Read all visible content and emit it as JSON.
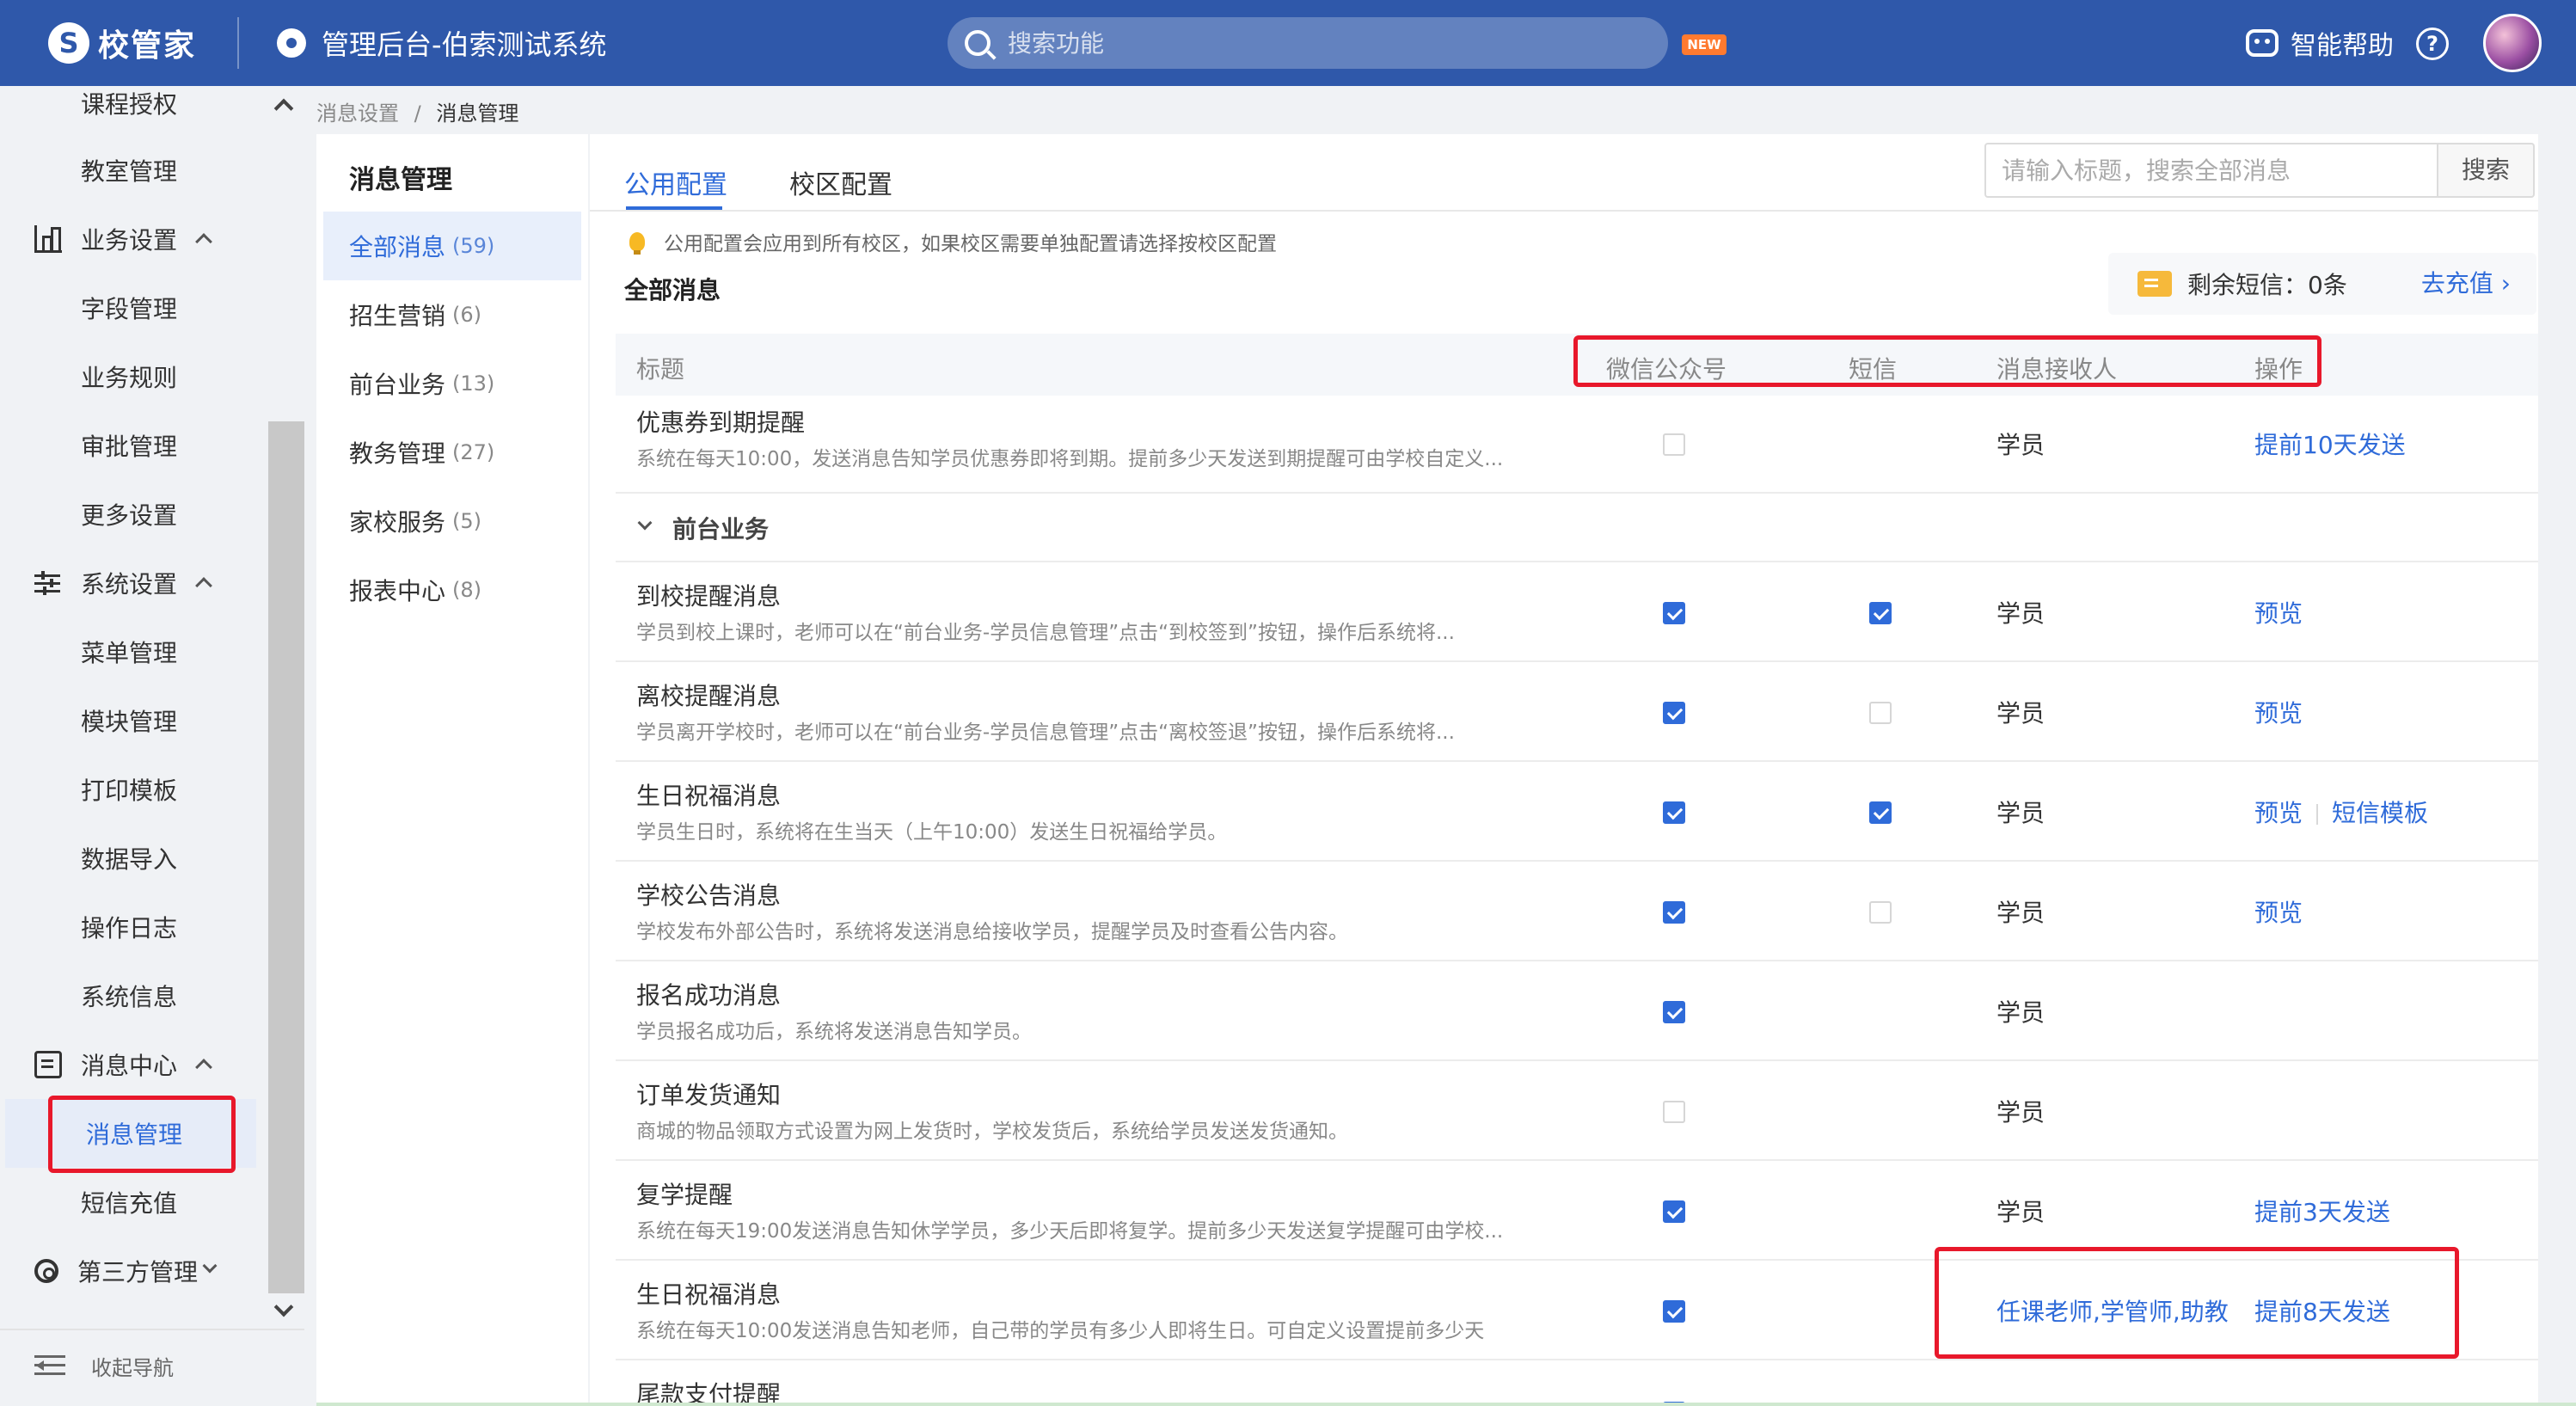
{
  "topbar": {
    "logo_mark": "S",
    "logo_text": "校管家",
    "app_title": "管理后台-伯索测试系统",
    "search_placeholder": "搜索功能",
    "new_badge": "NEW",
    "help_label": "智能帮助",
    "question_symbol": "?"
  },
  "sidebar": {
    "items": [
      {
        "label": "课程授权"
      },
      {
        "label": "教室管理"
      },
      {
        "label": "业务设置"
      },
      {
        "label": "字段管理"
      },
      {
        "label": "业务规则"
      },
      {
        "label": "审批管理"
      },
      {
        "label": "更多设置"
      },
      {
        "label": "系统设置"
      },
      {
        "label": "菜单管理"
      },
      {
        "label": "模块管理"
      },
      {
        "label": "打印模板"
      },
      {
        "label": "数据导入"
      },
      {
        "label": "操作日志"
      },
      {
        "label": "系统信息"
      },
      {
        "label": "消息中心"
      },
      {
        "label": "消息管理"
      },
      {
        "label": "短信充值"
      },
      {
        "label": "第三方管理"
      }
    ],
    "collapse_label": "收起导航"
  },
  "breadcrumb": {
    "parent": "消息设置",
    "sep": "/",
    "current": "消息管理"
  },
  "categories": {
    "title": "消息管理",
    "items": [
      {
        "label": "全部消息",
        "count": "(59)"
      },
      {
        "label": "招生营销",
        "count": "(6)"
      },
      {
        "label": "前台业务",
        "count": "(13)"
      },
      {
        "label": "教务管理",
        "count": "(27)"
      },
      {
        "label": "家校服务",
        "count": "(5)"
      },
      {
        "label": "报表中心",
        "count": "(8)"
      }
    ]
  },
  "main": {
    "tabs": [
      {
        "label": "公用配置"
      },
      {
        "label": "校区配置"
      }
    ],
    "search_placeholder": "请输入标题，搜索全部消息",
    "search_button": "搜索",
    "hint": "公用配置会应用到所有校区，如果校区需要单独配置请选择按校区配置",
    "section_title": "全部消息",
    "sms_balance": "剩余短信：0条",
    "recharge": "去充值 ›",
    "columns": {
      "title": "标题",
      "wechat": "微信公众号",
      "sms": "短信",
      "receiver": "消息接收人",
      "action": "操作"
    },
    "group_label": "前台业务",
    "rows": [
      {
        "title": "优惠券到期提醒",
        "desc": "系统在每天10:00，发送消息告知学员优惠券即将到期。提前多少天发送到期提醒可由学校自定义...",
        "wechat": false,
        "sms": null,
        "receiver": "学员",
        "ops": [
          "提前10天发送"
        ]
      },
      {
        "title": "到校提醒消息",
        "desc": "学员到校上课时，老师可以在“前台业务-学员信息管理”点击“到校签到”按钮，操作后系统将...",
        "wechat": true,
        "sms": true,
        "receiver": "学员",
        "ops": [
          "预览"
        ]
      },
      {
        "title": "离校提醒消息",
        "desc": "学员离开学校时，老师可以在“前台业务-学员信息管理”点击“离校签退”按钮，操作后系统将...",
        "wechat": true,
        "sms": false,
        "receiver": "学员",
        "ops": [
          "预览"
        ]
      },
      {
        "title": "生日祝福消息",
        "desc": "学员生日时，系统将在生当天（上午10:00）发送生日祝福给学员。",
        "wechat": true,
        "sms": true,
        "receiver": "学员",
        "ops": [
          "预览",
          "短信模板"
        ]
      },
      {
        "title": "学校公告消息",
        "desc": "学校发布外部公告时，系统将发送消息给接收学员，提醒学员及时查看公告内容。",
        "wechat": true,
        "sms": false,
        "receiver": "学员",
        "ops": [
          "预览"
        ]
      },
      {
        "title": "报名成功消息",
        "desc": "学员报名成功后，系统将发送消息告知学员。",
        "wechat": true,
        "sms": null,
        "receiver": "学员",
        "ops": []
      },
      {
        "title": "订单发货通知",
        "desc": "商城的物品领取方式设置为网上发货时，学校发货后，系统给学员发送发货通知。",
        "wechat": false,
        "sms": null,
        "receiver": "学员",
        "ops": []
      },
      {
        "title": "复学提醒",
        "desc": "系统在每天19:00发送消息告知休学学员，多少天后即将复学。提前多少天发送复学提醒可由学校...",
        "wechat": true,
        "sms": null,
        "receiver": "学员",
        "ops": [
          "提前3天发送"
        ]
      },
      {
        "title": "生日祝福消息",
        "desc": "系统在每天10:00发送消息告知老师，自己带的学员有多少人即将生日。可自定义设置提前多少天",
        "wechat": true,
        "sms": null,
        "receiver": "任课老师,学管师,助教",
        "ops": [
          "提前8天发送"
        ]
      },
      {
        "title": "尾款支付提醒",
        "desc": "",
        "wechat": true,
        "sms": null,
        "receiver": "学员",
        "ops": []
      }
    ]
  },
  "colors": {
    "brand": "#2f58aa",
    "link": "#2f6bd9",
    "highlight": "#e8182b",
    "checkbox": "#2f6bd9"
  }
}
